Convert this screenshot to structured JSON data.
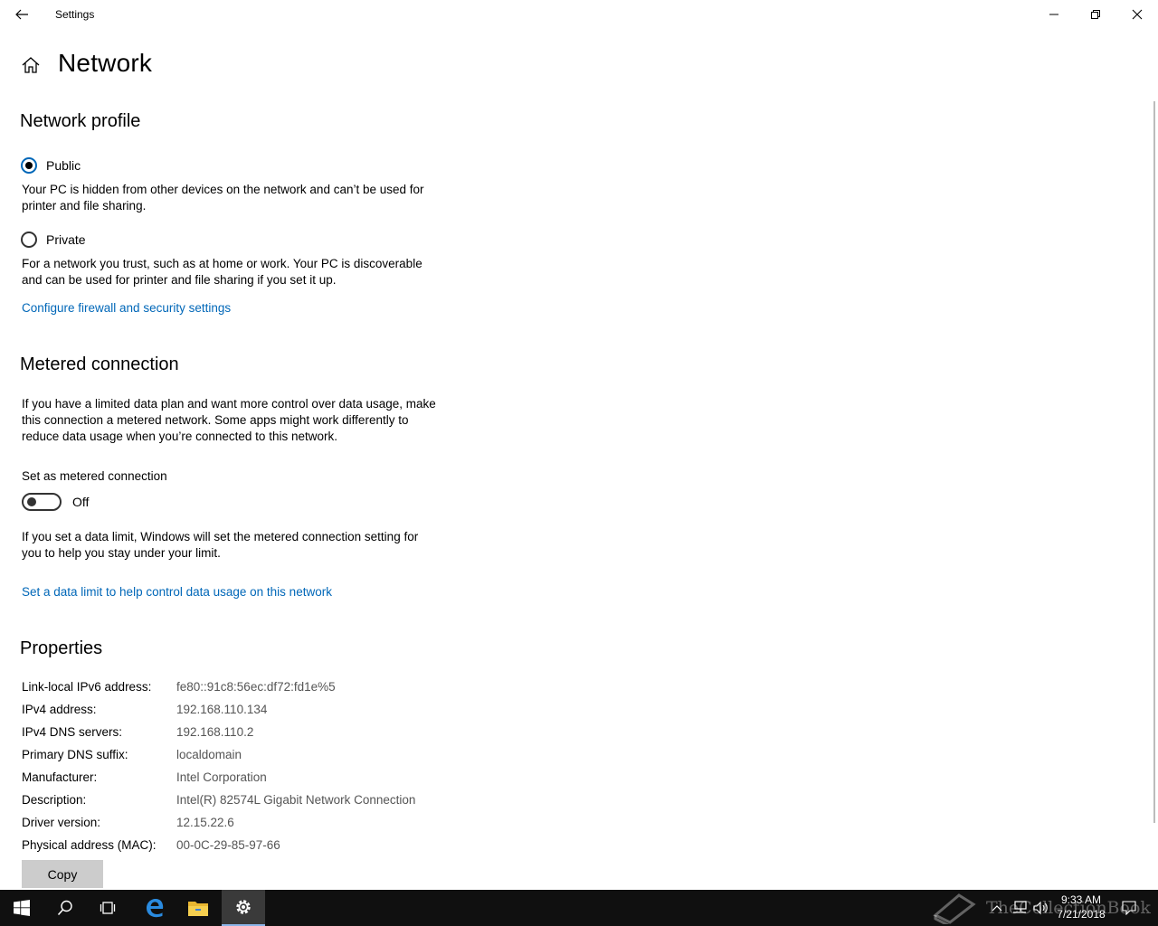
{
  "window": {
    "title": "Settings"
  },
  "page": {
    "title": "Network"
  },
  "network_profile": {
    "heading": "Network profile",
    "public_label": "Public",
    "public_description": "Your PC is hidden from other devices on the network and can’t be used for printer and file sharing.",
    "private_label": "Private",
    "private_description": "For a network you trust, such as at home or work. Your PC is discoverable and can be used for printer and file sharing if you set it up.",
    "selected": "Public",
    "firewall_link": "Configure firewall and security settings"
  },
  "metered": {
    "heading": "Metered connection",
    "description": "If you have a limited data plan and want more control over data usage, make this connection a metered network. Some apps might work differently to reduce data usage when you’re connected to this network.",
    "toggle_label": "Set as metered connection",
    "toggle_state": "Off",
    "data_limit_note": "If you set a data limit, Windows will set the metered connection setting for you to help you stay under your limit.",
    "data_limit_link": "Set a data limit to help control data usage on this network"
  },
  "properties": {
    "heading": "Properties",
    "rows": [
      {
        "label": "Link-local IPv6 address:",
        "value": "fe80::91c8:56ec:df72:fd1e%5"
      },
      {
        "label": "IPv4 address:",
        "value": "192.168.110.134"
      },
      {
        "label": "IPv4 DNS servers:",
        "value": "192.168.110.2"
      },
      {
        "label": "Primary DNS suffix:",
        "value": "localdomain"
      },
      {
        "label": "Manufacturer:",
        "value": "Intel Corporation"
      },
      {
        "label": "Description:",
        "value": "Intel(R) 82574L Gigabit Network Connection"
      },
      {
        "label": "Driver version:",
        "value": "12.15.22.6"
      },
      {
        "label": "Physical address (MAC):",
        "value": "00-0C-29-85-97-66"
      }
    ],
    "copy_label": "Copy"
  },
  "taskbar": {
    "time": "9:33 AM",
    "date": "7/21/2018",
    "watermark": "TheCollectionBook",
    "items": [
      "start-icon",
      "search-icon",
      "task-view-icon",
      "edge-icon",
      "file-explorer-icon",
      "settings-icon"
    ]
  },
  "colors": {
    "accent": "#0067b8",
    "taskbar": "#101010"
  }
}
